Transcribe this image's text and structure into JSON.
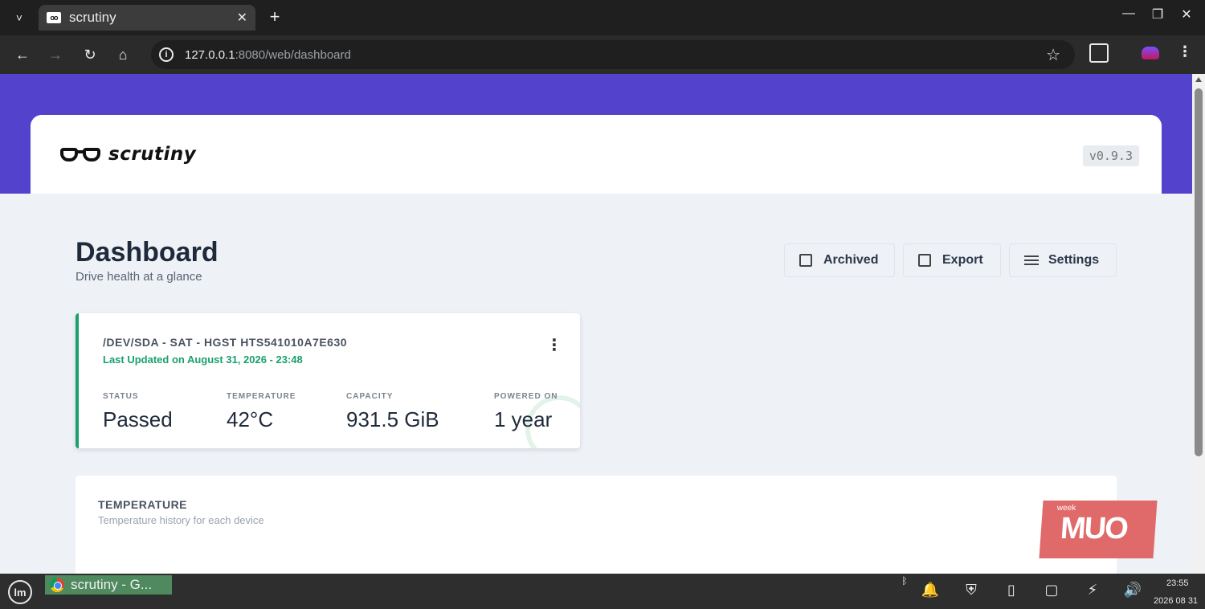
{
  "browser": {
    "tab_title": "scrutiny",
    "favicon_text": "oo",
    "url_host": "127.0.0.1",
    "url_rest": ":8080/web/dashboard",
    "icons": {
      "tab_dropdown": "˅",
      "tab_close": "✕",
      "new_tab": "+",
      "minimize": "—",
      "maximize": "❐",
      "close": "✕",
      "back": "←",
      "forward": "→",
      "reload": "↻",
      "home": "⌂",
      "info": "i",
      "star": "☆",
      "menu": "⋮"
    }
  },
  "app": {
    "logo_text": "scrutiny",
    "version": "v0.9.3"
  },
  "dashboard": {
    "title": "Dashboard",
    "subtitle": "Drive health at a glance",
    "actions": {
      "archived": "Archived",
      "export": "Export",
      "settings": "Settings"
    }
  },
  "drive": {
    "title": "/DEV/SDA - SAT - HGST HTS541010A7E630",
    "updated": "Last Updated on August 31, 2026 - 23:48",
    "kebab": "⋮",
    "status_color": "#1aa06d",
    "stats": {
      "status_label": "STATUS",
      "status_value": "Passed",
      "temperature_label": "TEMPERATURE",
      "temperature_value": "42°C",
      "capacity_label": "CAPACITY",
      "capacity_value": "931.5 GiB",
      "powered_label": "POWERED ON",
      "powered_value": "1 year"
    }
  },
  "temperature_panel": {
    "title": "TEMPERATURE",
    "subtitle": "Temperature history for each device"
  },
  "watermark": {
    "small": "week",
    "big": "MUO"
  },
  "taskbar": {
    "mint_logo": "lm",
    "task_label": "scrutiny - G...",
    "time": "23:55",
    "date": "2026 08 31",
    "icons": {
      "bluetooth": "ᛒ",
      "bell": "🔔",
      "shield": "⛨",
      "clipboard": "▯",
      "window": "▢",
      "power": "⚡",
      "volume": "🔊"
    }
  },
  "colors": {
    "accent": "#5242cc",
    "passed": "#1aa06d"
  }
}
